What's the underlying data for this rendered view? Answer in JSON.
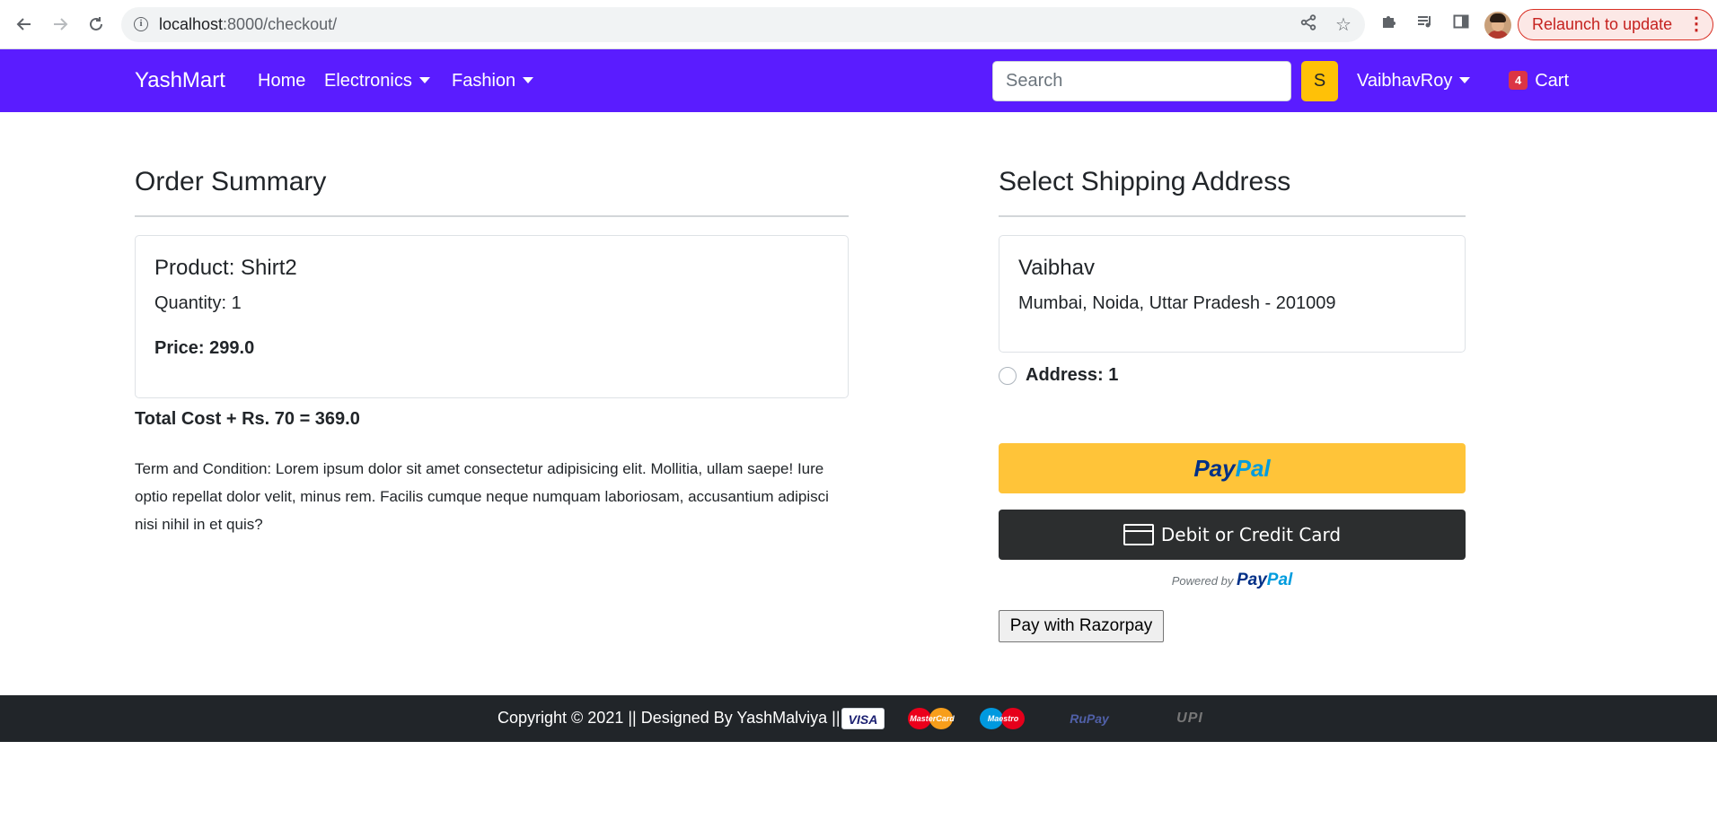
{
  "browser": {
    "url_host": "localhost",
    "url_rest": ":8000/checkout/",
    "relaunch_label": "Relaunch to update",
    "icons": [
      "back-arrow-icon",
      "forward-arrow-icon",
      "reload-icon",
      "info-icon",
      "share-icon",
      "star-icon",
      "puzzle-icon",
      "media-icon",
      "side-panel-icon",
      "kebab-menu-icon"
    ]
  },
  "navbar": {
    "brand": "YashMart",
    "links": [
      {
        "label": "Home"
      },
      {
        "label": "Electronics",
        "dropdown": true
      },
      {
        "label": "Fashion",
        "dropdown": true
      }
    ],
    "search_placeholder": "Search",
    "search_button": "S",
    "user": "VaibhavRoy",
    "cart_count": "4",
    "cart_label": "Cart",
    "colors": {
      "bar": "#5a1cff",
      "search_button": "#ffc107",
      "badge": "#dc3545"
    }
  },
  "order": {
    "title": "Order Summary",
    "product": "Product: Shirt2",
    "quantity": "Quantity: 1",
    "price": "Price: 299.0",
    "total": "Total Cost + Rs. 70 = 369.0",
    "terms": "Term and Condition: Lorem ipsum dolor sit amet consectetur adipisicing elit. Mollitia, ullam saepe! Iure optio repellat dolor velit, minus rem. Facilis cumque neque numquam laboriosam, accusantium adipisci nisi nihil in et quis?"
  },
  "shipping": {
    "title": "Select Shipping Address",
    "name": "Vaibhav",
    "address": "Mumbai, Noida, Uttar Pradesh - 201009",
    "radio_label": "Address: 1",
    "radio_checked": false
  },
  "payment": {
    "paypal_pay": "Pay",
    "paypal_pal": "Pal",
    "card_button": "Debit or Credit Card",
    "powered_by": "Powered by",
    "razorpay_button": "Pay with Razorpay",
    "colors": {
      "paypal": "#ffc439",
      "card": "#2c2e2f"
    }
  },
  "footer": {
    "text": "Copyright © 2021 || Designed By YashMalviya ||",
    "logos": {
      "visa": "VISA",
      "mastercard": "MasterCard",
      "maestro": "Maestro",
      "rupay": "RuPay",
      "upi": "UPI"
    }
  }
}
